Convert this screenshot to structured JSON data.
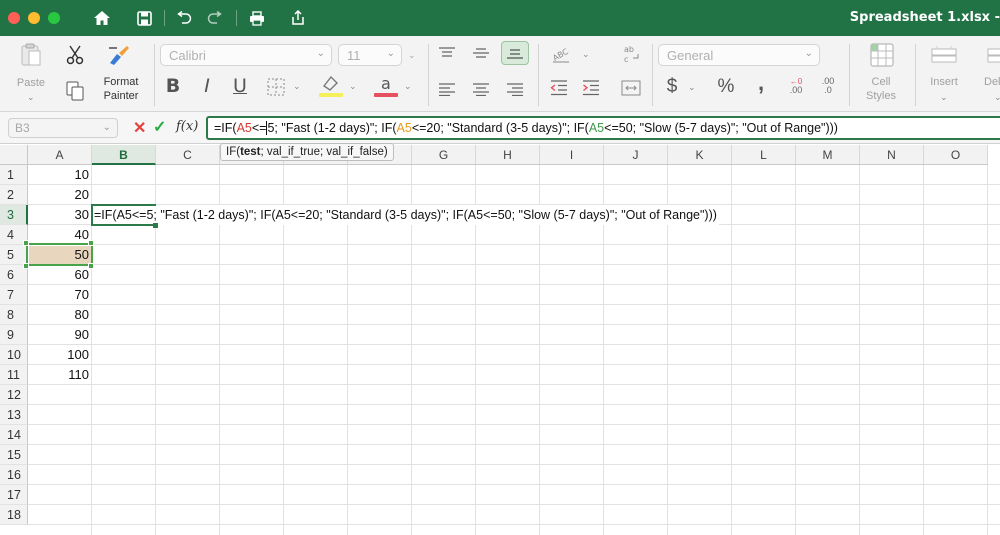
{
  "window": {
    "title": "Spreadsheet 1.xlsx -"
  },
  "ribbon": {
    "paste_label": "Paste",
    "format_painter_label_1": "Format",
    "format_painter_label_2": "Painter",
    "font_name": "Calibri",
    "font_size": "11",
    "number_format": "General",
    "bold_glyph": "B",
    "italic_glyph": "I",
    "underline_glyph": "U",
    "currency_glyph": "$",
    "percent_glyph": "%",
    "comma_glyph": ",",
    "increase_decimal": ".00",
    "decrease_decimal": ".0",
    "cell_styles_label_1": "Cell",
    "cell_styles_label_2": "Styles",
    "insert_label": "Insert",
    "delete_label": "Del"
  },
  "formula_bar": {
    "name_box": "B3",
    "fx_label": "f(x)",
    "formula_p1": "=IF(",
    "ref1": "A5",
    "formula_p2a": "<=",
    "formula_p2b": "5; \"Fast (1-2 days)\"; IF(",
    "ref2": "A5",
    "formula_p3": "<=20; \"Standard (3-5 days)\"; IF(",
    "ref3": "A5",
    "formula_p4": "<=50; \"Slow (5-7 days)\"; \"Out of Range\")))",
    "tooltip_prefix": "IF(",
    "tooltip_bold": "test",
    "tooltip_rest": "; val_if_true; val_if_false)"
  },
  "grid": {
    "columns": [
      "A",
      "B",
      "C",
      "D",
      "E",
      "F",
      "G",
      "H",
      "I",
      "J",
      "K",
      "L",
      "M",
      "N",
      "O"
    ],
    "rows": [
      "1",
      "2",
      "3",
      "4",
      "5",
      "6",
      "7",
      "8",
      "9",
      "10",
      "11",
      "12",
      "13",
      "14",
      "15",
      "16",
      "17",
      "18"
    ],
    "column_a_values": [
      "10",
      "20",
      "30",
      "40",
      "50",
      "60",
      "70",
      "80",
      "90",
      "100",
      "110"
    ],
    "b3_text": "=IF(A5<=5; \"Fast (1-2 days)\"; IF(A5<=20; \"Standard (3-5 days)\"; IF(A5<=50; \"Slow (5-7 days)\"; \"Out of Range\")))",
    "selected_column": "B",
    "selected_row": "3"
  },
  "colors": {
    "accent": "#217346",
    "ref1": "#d6392f",
    "ref2": "#e69a1c",
    "ref3": "#3c9a4a",
    "a5_fill": "#e8d7be"
  }
}
